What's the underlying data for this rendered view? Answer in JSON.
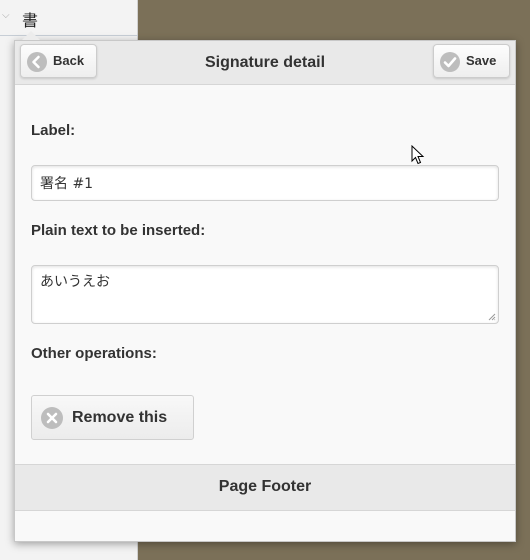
{
  "sidebar": {
    "chevron_icon": "chevron-down-icon",
    "item_label": "書"
  },
  "header": {
    "title": "Signature detail",
    "back_label": "Back",
    "back_icon": "arrow-left-circle-icon",
    "save_label": "Save",
    "save_icon": "check-circle-icon"
  },
  "form": {
    "label_field_label": "Label:",
    "label_value": "署名 #1",
    "text_field_label": "Plain text to be inserted:",
    "text_value": "あいうえお",
    "other_ops_label": "Other operations:",
    "remove_label": "Remove this",
    "remove_icon": "delete-circle-icon"
  },
  "footer": {
    "title": "Page Footer"
  },
  "colors": {
    "backdrop": "#7b7058",
    "header_bg": "#e9e9e9",
    "panel_bg": "#f9f9f9",
    "icon_gray": "#bdbdbd"
  }
}
